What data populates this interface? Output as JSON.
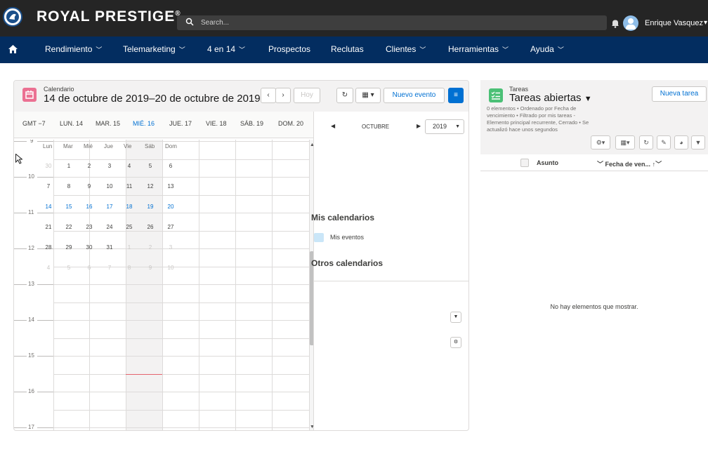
{
  "header": {
    "brand": "ROYAL PRESTIGE",
    "brand_mark": "®",
    "search_placeholder": "Search...",
    "user_name": "Enrique Vasquez"
  },
  "nav": {
    "items": [
      {
        "label": "Rendimiento",
        "dropdown": true
      },
      {
        "label": "Telemarketing",
        "dropdown": true
      },
      {
        "label": "4 en 14",
        "dropdown": true
      },
      {
        "label": "Prospectos",
        "dropdown": false
      },
      {
        "label": "Reclutas",
        "dropdown": false
      },
      {
        "label": "Clientes",
        "dropdown": true
      },
      {
        "label": "Herramientas",
        "dropdown": true
      },
      {
        "label": "Ayuda",
        "dropdown": true
      }
    ]
  },
  "calendar": {
    "subtitle": "Calendario",
    "title": "14 de octubre de 2019–20 de octubre de 2019",
    "today_label": "Hoy",
    "new_event_label": "Nuevo evento",
    "timezone": "GMT −7",
    "days": [
      "LUN. 14",
      "MAR. 15",
      "MIÉ. 16",
      "JUE. 17",
      "VIE. 18",
      "SÁB. 19",
      "DOM. 20"
    ],
    "today_index": 2,
    "hours": [
      "9",
      "10",
      "11",
      "12",
      "13",
      "14",
      "15",
      "16",
      "17"
    ],
    "mini": {
      "month": "OCTUBRE",
      "year": "2019",
      "weekdays": [
        "Lun",
        "Mar",
        "Mié",
        "Jue",
        "Vie",
        "Sáb",
        "Dom"
      ],
      "weeks": [
        [
          "30",
          "1",
          "2",
          "3",
          "4",
          "5",
          "6"
        ],
        [
          "7",
          "8",
          "9",
          "10",
          "11",
          "12",
          "13"
        ],
        [
          "14",
          "15",
          "16",
          "17",
          "18",
          "19",
          "20"
        ],
        [
          "21",
          "22",
          "23",
          "24",
          "25",
          "26",
          "27"
        ],
        [
          "28",
          "29",
          "30",
          "31",
          "1",
          "2",
          "3"
        ],
        [
          "4",
          "5",
          "6",
          "7",
          "8",
          "9",
          "10"
        ]
      ],
      "current_week_index": 2,
      "outside_days": [
        [
          0,
          0
        ],
        [
          4,
          4
        ],
        [
          4,
          5
        ],
        [
          4,
          6
        ],
        [
          5,
          0
        ],
        [
          5,
          1
        ],
        [
          5,
          2
        ],
        [
          5,
          3
        ],
        [
          5,
          4
        ],
        [
          5,
          5
        ],
        [
          5,
          6
        ]
      ]
    },
    "my_calendars_title": "Mis calendarios",
    "my_events_label": "Mis eventos",
    "other_calendars_title": "Otros calendarios"
  },
  "tasks": {
    "subtitle": "Tareas",
    "title": "Tareas abiertas",
    "new_task_label": "Nueva tarea",
    "meta": "0 elementos • Ordenado por Fecha de vencimiento • Filtrado por mis tareas - Elemento principal recurrente, Cerrado • Se actualizó hace unos segundos",
    "col_subject": "Asunto",
    "col_due": "Fecha de ven...",
    "empty_message": "No hay elementos que mostrar."
  },
  "colors": {
    "header_bg": "#252525",
    "nav_bg": "#032d60",
    "accent": "#0070d2",
    "calendar_icon": "#eb7092",
    "task_icon": "#4bc076",
    "now_line": "#e5646e"
  }
}
